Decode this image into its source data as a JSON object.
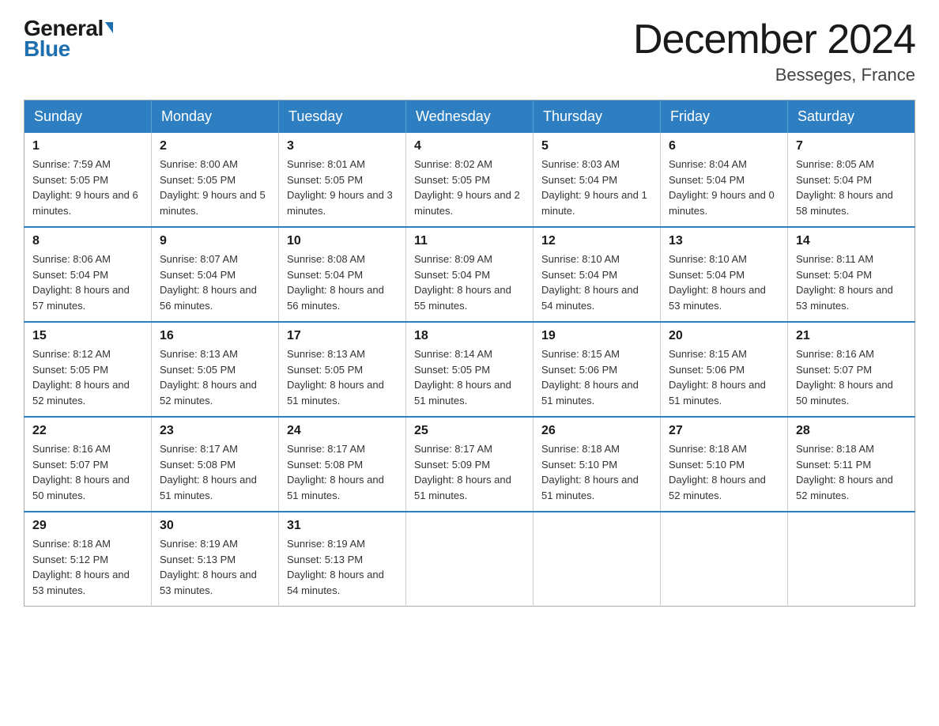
{
  "header": {
    "logo_general": "General",
    "logo_blue": "Blue",
    "month_title": "December 2024",
    "location": "Besseges, France"
  },
  "days_of_week": [
    "Sunday",
    "Monday",
    "Tuesday",
    "Wednesday",
    "Thursday",
    "Friday",
    "Saturday"
  ],
  "weeks": [
    [
      {
        "day": "1",
        "sunrise": "Sunrise: 7:59 AM",
        "sunset": "Sunset: 5:05 PM",
        "daylight": "Daylight: 9 hours and 6 minutes."
      },
      {
        "day": "2",
        "sunrise": "Sunrise: 8:00 AM",
        "sunset": "Sunset: 5:05 PM",
        "daylight": "Daylight: 9 hours and 5 minutes."
      },
      {
        "day": "3",
        "sunrise": "Sunrise: 8:01 AM",
        "sunset": "Sunset: 5:05 PM",
        "daylight": "Daylight: 9 hours and 3 minutes."
      },
      {
        "day": "4",
        "sunrise": "Sunrise: 8:02 AM",
        "sunset": "Sunset: 5:05 PM",
        "daylight": "Daylight: 9 hours and 2 minutes."
      },
      {
        "day": "5",
        "sunrise": "Sunrise: 8:03 AM",
        "sunset": "Sunset: 5:04 PM",
        "daylight": "Daylight: 9 hours and 1 minute."
      },
      {
        "day": "6",
        "sunrise": "Sunrise: 8:04 AM",
        "sunset": "Sunset: 5:04 PM",
        "daylight": "Daylight: 9 hours and 0 minutes."
      },
      {
        "day": "7",
        "sunrise": "Sunrise: 8:05 AM",
        "sunset": "Sunset: 5:04 PM",
        "daylight": "Daylight: 8 hours and 58 minutes."
      }
    ],
    [
      {
        "day": "8",
        "sunrise": "Sunrise: 8:06 AM",
        "sunset": "Sunset: 5:04 PM",
        "daylight": "Daylight: 8 hours and 57 minutes."
      },
      {
        "day": "9",
        "sunrise": "Sunrise: 8:07 AM",
        "sunset": "Sunset: 5:04 PM",
        "daylight": "Daylight: 8 hours and 56 minutes."
      },
      {
        "day": "10",
        "sunrise": "Sunrise: 8:08 AM",
        "sunset": "Sunset: 5:04 PM",
        "daylight": "Daylight: 8 hours and 56 minutes."
      },
      {
        "day": "11",
        "sunrise": "Sunrise: 8:09 AM",
        "sunset": "Sunset: 5:04 PM",
        "daylight": "Daylight: 8 hours and 55 minutes."
      },
      {
        "day": "12",
        "sunrise": "Sunrise: 8:10 AM",
        "sunset": "Sunset: 5:04 PM",
        "daylight": "Daylight: 8 hours and 54 minutes."
      },
      {
        "day": "13",
        "sunrise": "Sunrise: 8:10 AM",
        "sunset": "Sunset: 5:04 PM",
        "daylight": "Daylight: 8 hours and 53 minutes."
      },
      {
        "day": "14",
        "sunrise": "Sunrise: 8:11 AM",
        "sunset": "Sunset: 5:04 PM",
        "daylight": "Daylight: 8 hours and 53 minutes."
      }
    ],
    [
      {
        "day": "15",
        "sunrise": "Sunrise: 8:12 AM",
        "sunset": "Sunset: 5:05 PM",
        "daylight": "Daylight: 8 hours and 52 minutes."
      },
      {
        "day": "16",
        "sunrise": "Sunrise: 8:13 AM",
        "sunset": "Sunset: 5:05 PM",
        "daylight": "Daylight: 8 hours and 52 minutes."
      },
      {
        "day": "17",
        "sunrise": "Sunrise: 8:13 AM",
        "sunset": "Sunset: 5:05 PM",
        "daylight": "Daylight: 8 hours and 51 minutes."
      },
      {
        "day": "18",
        "sunrise": "Sunrise: 8:14 AM",
        "sunset": "Sunset: 5:05 PM",
        "daylight": "Daylight: 8 hours and 51 minutes."
      },
      {
        "day": "19",
        "sunrise": "Sunrise: 8:15 AM",
        "sunset": "Sunset: 5:06 PM",
        "daylight": "Daylight: 8 hours and 51 minutes."
      },
      {
        "day": "20",
        "sunrise": "Sunrise: 8:15 AM",
        "sunset": "Sunset: 5:06 PM",
        "daylight": "Daylight: 8 hours and 51 minutes."
      },
      {
        "day": "21",
        "sunrise": "Sunrise: 8:16 AM",
        "sunset": "Sunset: 5:07 PM",
        "daylight": "Daylight: 8 hours and 50 minutes."
      }
    ],
    [
      {
        "day": "22",
        "sunrise": "Sunrise: 8:16 AM",
        "sunset": "Sunset: 5:07 PM",
        "daylight": "Daylight: 8 hours and 50 minutes."
      },
      {
        "day": "23",
        "sunrise": "Sunrise: 8:17 AM",
        "sunset": "Sunset: 5:08 PM",
        "daylight": "Daylight: 8 hours and 51 minutes."
      },
      {
        "day": "24",
        "sunrise": "Sunrise: 8:17 AM",
        "sunset": "Sunset: 5:08 PM",
        "daylight": "Daylight: 8 hours and 51 minutes."
      },
      {
        "day": "25",
        "sunrise": "Sunrise: 8:17 AM",
        "sunset": "Sunset: 5:09 PM",
        "daylight": "Daylight: 8 hours and 51 minutes."
      },
      {
        "day": "26",
        "sunrise": "Sunrise: 8:18 AM",
        "sunset": "Sunset: 5:10 PM",
        "daylight": "Daylight: 8 hours and 51 minutes."
      },
      {
        "day": "27",
        "sunrise": "Sunrise: 8:18 AM",
        "sunset": "Sunset: 5:10 PM",
        "daylight": "Daylight: 8 hours and 52 minutes."
      },
      {
        "day": "28",
        "sunrise": "Sunrise: 8:18 AM",
        "sunset": "Sunset: 5:11 PM",
        "daylight": "Daylight: 8 hours and 52 minutes."
      }
    ],
    [
      {
        "day": "29",
        "sunrise": "Sunrise: 8:18 AM",
        "sunset": "Sunset: 5:12 PM",
        "daylight": "Daylight: 8 hours and 53 minutes."
      },
      {
        "day": "30",
        "sunrise": "Sunrise: 8:19 AM",
        "sunset": "Sunset: 5:13 PM",
        "daylight": "Daylight: 8 hours and 53 minutes."
      },
      {
        "day": "31",
        "sunrise": "Sunrise: 8:19 AM",
        "sunset": "Sunset: 5:13 PM",
        "daylight": "Daylight: 8 hours and 54 minutes."
      },
      null,
      null,
      null,
      null
    ]
  ]
}
